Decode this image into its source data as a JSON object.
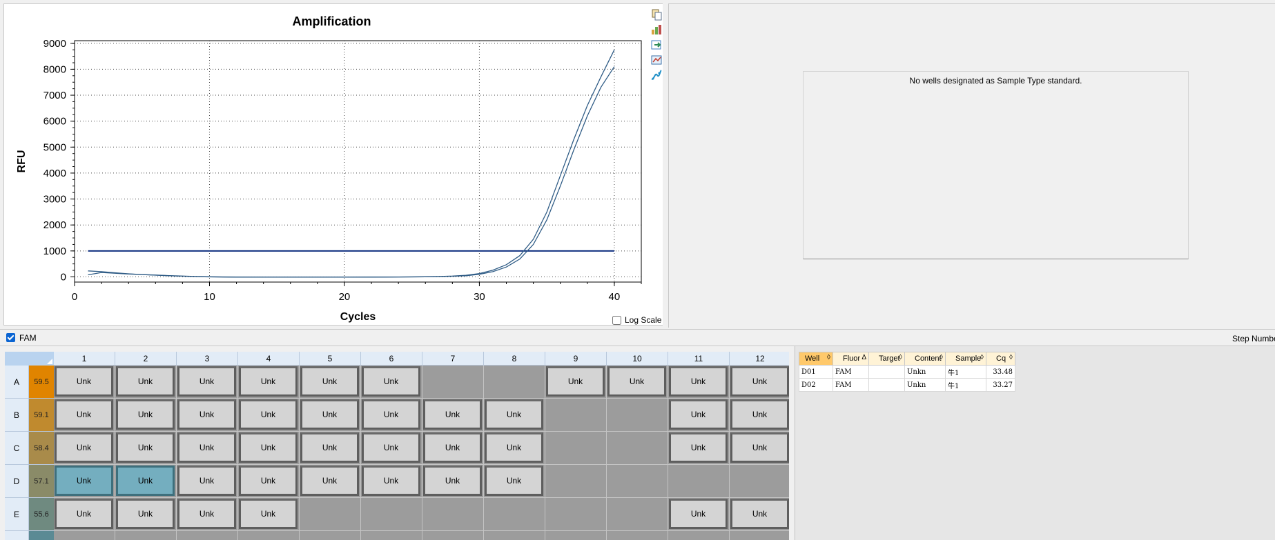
{
  "chart": {
    "title": "Amplification",
    "xlabel": "Cycles",
    "ylabel": "RFU",
    "log_scale_label": "Log Scale",
    "log_scale_checked": false,
    "toolbar_icons": [
      "copy-icon",
      "chart-settings-icon",
      "export-icon",
      "zoom-icon",
      "curve-icon"
    ]
  },
  "chart_data": {
    "type": "line",
    "title": "Amplification",
    "xlabel": "Cycles",
    "ylabel": "RFU",
    "xlim": [
      0,
      42
    ],
    "ylim": [
      -200,
      9100
    ],
    "x_ticks": [
      0,
      10,
      20,
      30,
      40
    ],
    "y_ticks": [
      0,
      1000,
      2000,
      3000,
      4000,
      5000,
      6000,
      7000,
      8000,
      9000
    ],
    "grid": true,
    "threshold": 1000,
    "series": [
      {
        "x": [
          1,
          2,
          3,
          4,
          5,
          6,
          7,
          8,
          9,
          10,
          11,
          12,
          13,
          14,
          15,
          16,
          17,
          18,
          19,
          20,
          21,
          22,
          23,
          24,
          25,
          26,
          27,
          28,
          29,
          30,
          31,
          32,
          33,
          34,
          35,
          36,
          37,
          38,
          39,
          40
        ],
        "values": [
          80,
          170,
          140,
          110,
          90,
          70,
          50,
          30,
          15,
          5,
          0,
          -5,
          -10,
          -10,
          -10,
          -10,
          -10,
          -10,
          -10,
          -10,
          -8,
          -6,
          -5,
          -3,
          0,
          5,
          15,
          30,
          60,
          130,
          260,
          470,
          820,
          1450,
          2500,
          3900,
          5300,
          6600,
          7700,
          8750
        ]
      },
      {
        "x": [
          1,
          2,
          3,
          4,
          5,
          6,
          7,
          8,
          9,
          10,
          11,
          12,
          13,
          14,
          15,
          16,
          17,
          18,
          19,
          20,
          21,
          22,
          23,
          24,
          25,
          26,
          27,
          28,
          29,
          30,
          31,
          32,
          33,
          34,
          35,
          36,
          37,
          38,
          39,
          40
        ],
        "values": [
          230,
          200,
          160,
          120,
          90,
          65,
          45,
          25,
          10,
          0,
          -5,
          -8,
          -10,
          -12,
          -12,
          -12,
          -12,
          -12,
          -12,
          -12,
          -10,
          -8,
          -6,
          -4,
          -2,
          3,
          10,
          22,
          45,
          100,
          200,
          380,
          690,
          1250,
          2200,
          3500,
          4900,
          6200,
          7300,
          8100
        ]
      }
    ],
    "colors": {
      "lines": "#2f5c86",
      "threshold": "#0f2f7f"
    }
  },
  "standard_curve": {
    "message": "No wells designated as Sample Type standard."
  },
  "filter": {
    "fam_label": "FAM",
    "fam_checked": true,
    "step_number_label": "Step Number"
  },
  "plate": {
    "columns": [
      "1",
      "2",
      "3",
      "4",
      "5",
      "6",
      "7",
      "8",
      "9",
      "10",
      "11",
      "12"
    ],
    "rows": [
      {
        "label": "A",
        "temp": "59.5",
        "temp_color": "#e08400",
        "wells": [
          "Unk",
          "Unk",
          "Unk",
          "Unk",
          "Unk",
          "Unk",
          "",
          "",
          "Unk",
          "Unk",
          "Unk",
          "Unk"
        ]
      },
      {
        "label": "B",
        "temp": "59.1",
        "temp_color": "#c08a2e",
        "wells": [
          "Unk",
          "Unk",
          "Unk",
          "Unk",
          "Unk",
          "Unk",
          "Unk",
          "Unk",
          "",
          "",
          "Unk",
          "Unk"
        ]
      },
      {
        "label": "C",
        "temp": "58.4",
        "temp_color": "#a98b4a",
        "wells": [
          "Unk",
          "Unk",
          "Unk",
          "Unk",
          "Unk",
          "Unk",
          "Unk",
          "Unk",
          "",
          "",
          "Unk",
          "Unk"
        ]
      },
      {
        "label": "D",
        "temp": "57.1",
        "temp_color": "#8a8b68",
        "wells": [
          "Unk",
          "Unk",
          "Unk",
          "Unk",
          "Unk",
          "Unk",
          "Unk",
          "Unk",
          "",
          "",
          "",
          ""
        ],
        "selected": [
          0,
          1
        ]
      },
      {
        "label": "E",
        "temp": "55.6",
        "temp_color": "#6f8a80",
        "wells": [
          "Unk",
          "Unk",
          "Unk",
          "Unk",
          "",
          "",
          "",
          "",
          "",
          "",
          "Unk",
          "Unk"
        ]
      },
      {
        "label": "",
        "temp": "",
        "temp_color": "#5b8a94",
        "wells": [
          "",
          "",
          "",
          "",
          "",
          "",
          "",
          "",
          "",
          "",
          "",
          ""
        ]
      }
    ]
  },
  "results": {
    "headers": [
      "Well",
      "Fluor",
      "Target",
      "Content",
      "Sample",
      "Cq"
    ],
    "sort_marks": [
      "◊",
      "Δ",
      "◊",
      "◊",
      "◊",
      "◊"
    ],
    "rows": [
      [
        "D01",
        "FAM",
        "",
        "Unkn",
        "牛1",
        "33.48"
      ],
      [
        "D02",
        "FAM",
        "",
        "Unkn",
        "牛1",
        "33.27"
      ]
    ]
  }
}
